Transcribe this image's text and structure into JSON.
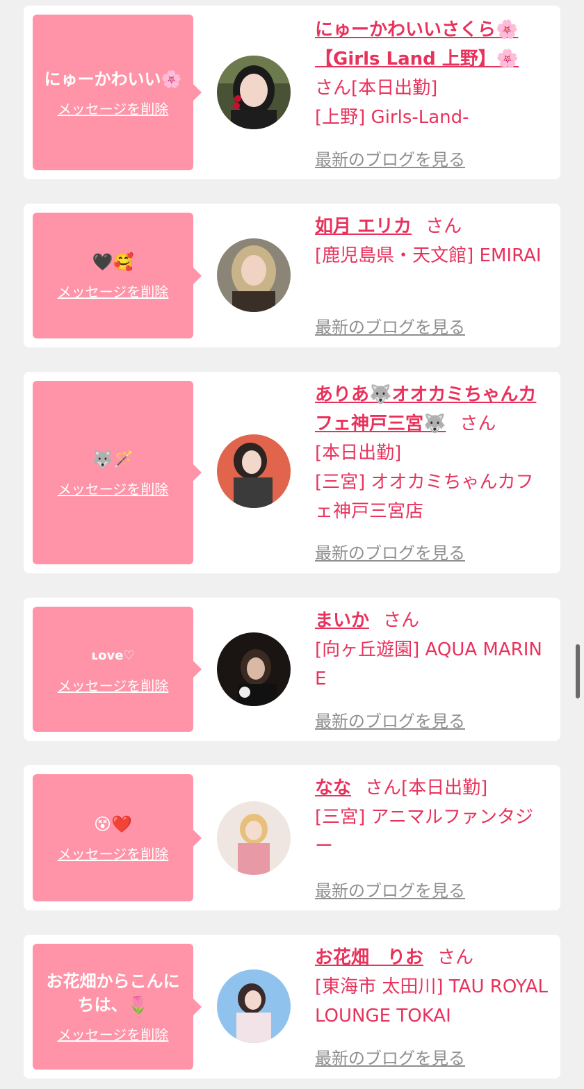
{
  "delete_label": "メッセージを削除",
  "blog_label": "最新のブログを見る",
  "honorific": "さん",
  "colors": {
    "bubble": "#ff94a8",
    "name": "#e8325c",
    "muted_link": "#8f8f8f",
    "card": "#ffffff",
    "page": "#f0f0f0"
  },
  "items": [
    {
      "message": "にゅーかわいい🌸",
      "name": "にゅーかわいいさくら🌸【Girls Land 上野】🌸",
      "status": "[本日出勤]",
      "shop": "[上野] Girls-Land-"
    },
    {
      "message": "🖤🥰",
      "name": "如月 エリカ",
      "status": "",
      "shop": "[鹿児島県・天文館] EMIRAI"
    },
    {
      "message": "🐺🪄",
      "name": "ありあ🐺オオカミちゃんカフェ神戸三宮🐺",
      "status": "[本日出勤]",
      "shop": "[三宮] オオカミちゃんカフェ神戸三宮店"
    },
    {
      "message": "ʟove♡",
      "name": "まいか",
      "status": "",
      "shop": "[向ヶ丘遊園] AQUA MARINE"
    },
    {
      "message": "😵❤️",
      "name": "なな",
      "status": "[本日出勤]",
      "shop": "[三宮] アニマルファンタジー"
    },
    {
      "message": "お花畑からこんにちは、🌷",
      "name": "お花畑　りお",
      "status": "",
      "shop": "[東海市 太田川] TAU ROYAL LOUNGE TOKAI"
    }
  ]
}
